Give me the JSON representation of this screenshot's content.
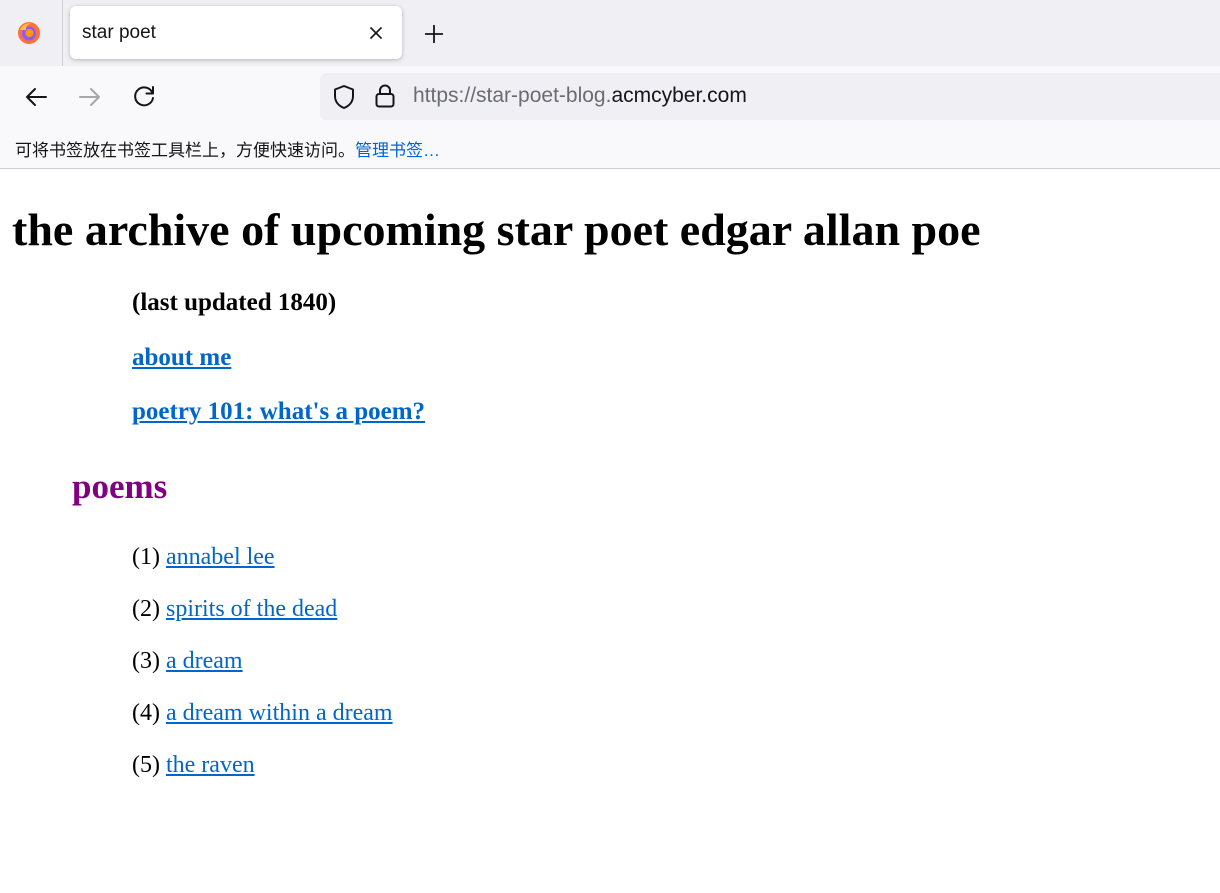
{
  "browser": {
    "tab": {
      "title": "star poet"
    },
    "address": {
      "scheme_and_sub": "https://star-poet-blog.",
      "domain": "acmcyber.com"
    },
    "bookmarks_bar": {
      "message": "可将书签放在书签工具栏上，方便快速访问。",
      "manage_link": "管理书签…"
    }
  },
  "page": {
    "title": "the archive of upcoming star poet edgar allan poe",
    "last_updated": "(last updated 1840)",
    "links": [
      {
        "label": "about me"
      },
      {
        "label": "poetry 101: what's a poem?"
      }
    ],
    "poems_heading": "poems",
    "poems": [
      {
        "index": "(1)",
        "title": "annabel lee"
      },
      {
        "index": "(2)",
        "title": "spirits of the dead"
      },
      {
        "index": "(3)",
        "title": "a dream"
      },
      {
        "index": "(4)",
        "title": "a dream within a dream"
      },
      {
        "index": "(5)",
        "title": "the raven"
      }
    ]
  },
  "colors": {
    "link": "#0066cc",
    "visited_heading": "#800080",
    "chrome_tabbar": "#f0f0f4",
    "chrome_toolbar": "#f9f9fb"
  },
  "icons": {
    "app": "firefox-logo-icon",
    "tab_close": "close-icon",
    "new_tab": "plus-icon",
    "back": "arrow-left-icon",
    "forward": "arrow-right-icon",
    "reload": "reload-icon",
    "tracking": "shield-icon",
    "security": "lock-icon"
  }
}
